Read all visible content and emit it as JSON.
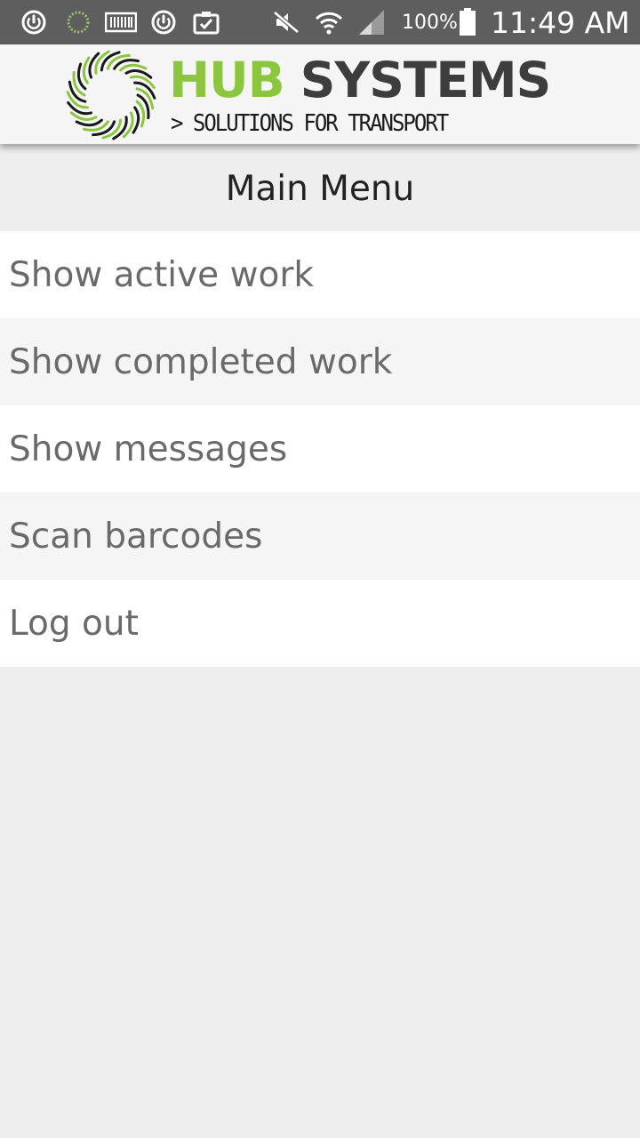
{
  "status_bar": {
    "battery_percent": "100%",
    "time": "11:49 AM",
    "left_icons": [
      "power-circle-icon",
      "loading-ring-icon",
      "barcode-icon",
      "power-circle-icon",
      "clipboard-check-icon"
    ],
    "right_icons": [
      "mute-icon",
      "wifi-icon",
      "signal-icon",
      "battery-icon"
    ]
  },
  "brand": {
    "name_part1": "HUB",
    "name_part2": "SYSTEMS",
    "tagline": "> SOLUTIONS FOR TRANSPORT",
    "colors": {
      "hub_green": "#8cc63f",
      "systems_gray": "#3d3d3d"
    }
  },
  "menu": {
    "title": "Main Menu",
    "items": [
      {
        "label": "Show active work"
      },
      {
        "label": "Show completed work"
      },
      {
        "label": "Show messages"
      },
      {
        "label": "Scan barcodes"
      },
      {
        "label": "Log out"
      }
    ]
  },
  "colors": {
    "status_bar_bg": "#5e5e5e",
    "page_bg": "#eeeeee",
    "menu_text": "#6a6a6a"
  }
}
